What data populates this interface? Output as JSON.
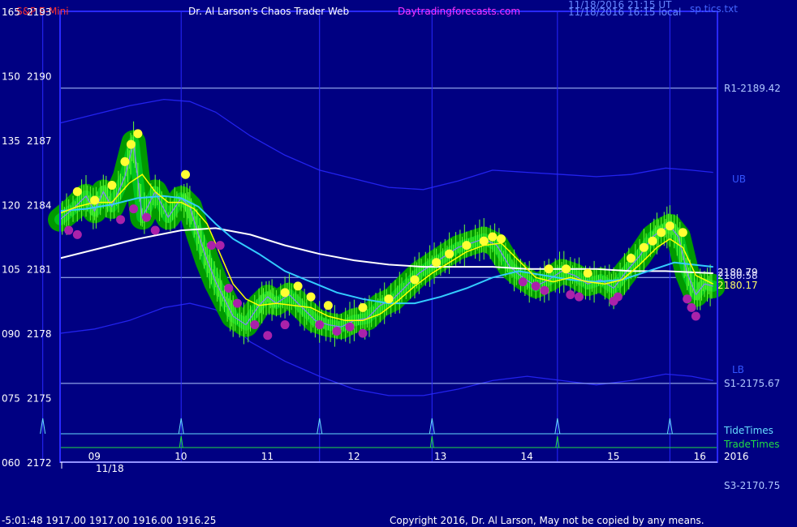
{
  "header": {
    "symbol": "S&P E-Mini",
    "site": "Dr. Al Larson's Chaos Trader Web",
    "url": "Daytradingforecasts.com",
    "stamp1": "11/18/2016 21:15 UT",
    "stamp2": "11/18/2016 16:15 local",
    "file": "sp.tics.txt"
  },
  "footer": {
    "quote": "-5:01:48  1917.00 1917.00 1916.00 1916.25",
    "copyright": "Copyright 2016, Dr. Al Larson, May not be copied by any means."
  },
  "colors": {
    "background": "#000082",
    "price_line": "#8080ff",
    "grid": "#2828ff",
    "ema_yellow": "#ffff00",
    "ema_cyan": "#33ccff",
    "ema_white": "#ffffff",
    "band": "#2222ee",
    "tide": "#66ddff",
    "trade": "#22dd44",
    "dot_yellow": "#ffff33",
    "dot_magenta": "#aa22aa",
    "halo": "#009900"
  },
  "chart_data": {
    "type": "line",
    "title": "S&P E-Mini",
    "ylim": [
      2172,
      2193
    ],
    "xlim": [
      8.6,
      16.2
    ],
    "y_ticks": [
      {
        "left": "165",
        "right": "2193",
        "y": 2193
      },
      {
        "left": "150",
        "right": "2190",
        "y": 2190
      },
      {
        "left": "135",
        "right": "2187",
        "y": 2187
      },
      {
        "left": "120",
        "right": "2184",
        "y": 2184
      },
      {
        "left": "105",
        "right": "2181",
        "y": 2181
      },
      {
        "left": "090",
        "right": "2178",
        "y": 2178
      },
      {
        "left": "075",
        "right": "2175",
        "y": 2175
      },
      {
        "left": "060",
        "right": "2172",
        "y": 2172
      }
    ],
    "x_ticks": [
      {
        "label": "09",
        "x": 9.0
      },
      {
        "label": "10",
        "x": 10.0
      },
      {
        "label": "11",
        "x": 11.0
      },
      {
        "label": "12",
        "x": 12.0
      },
      {
        "label": "13",
        "x": 13.0
      },
      {
        "label": "14",
        "x": 14.0
      },
      {
        "label": "15",
        "x": 15.0
      },
      {
        "label": "16",
        "x": 16.0
      }
    ],
    "date_label": "11/18",
    "levels": [
      {
        "label": "R1-2189.42",
        "value": 2189.42
      },
      {
        "label": "S1-2175.67",
        "value": 2175.67
      }
    ],
    "below_label": "S3-2170.75",
    "band_labels": {
      "upper": "UB",
      "lower": "LB"
    },
    "last_values": [
      "2180.79",
      "2180.58",
      "2180.17"
    ],
    "year_label": "2016",
    "vertical_times": [
      8.4,
      10.0,
      11.6,
      12.9,
      14.35,
      15.65
    ],
    "tide": {
      "label": "TideTimes",
      "times": [
        8.4,
        10.0,
        11.6,
        12.9,
        14.35,
        15.65
      ]
    },
    "trade": {
      "label": "TradeTimes",
      "times": [
        10.0,
        12.9,
        14.35
      ]
    },
    "series": [
      {
        "key": "price",
        "x": [
          8.6,
          8.75,
          8.9,
          9.0,
          9.1,
          9.2,
          9.35,
          9.45,
          9.55,
          9.7,
          9.85,
          10.0,
          10.1,
          10.2,
          10.3,
          10.4,
          10.5,
          10.6,
          10.75,
          10.9,
          11.0,
          11.1,
          11.25,
          11.4,
          11.55,
          11.7,
          11.85,
          12.0,
          12.15,
          12.3,
          12.45,
          12.6,
          12.75,
          12.9,
          13.05,
          13.2,
          13.35,
          13.5,
          13.65,
          13.8,
          13.95,
          14.1,
          14.25,
          14.4,
          14.55,
          14.7,
          14.85,
          15.0,
          15.15,
          15.3,
          15.45,
          15.55,
          15.65,
          15.75,
          15.85,
          15.95,
          16.05,
          16.15
        ],
        "y": [
          2183.3,
          2183.8,
          2184.4,
          2183.7,
          2184.6,
          2183.9,
          2185.3,
          2186.9,
          2183.4,
          2184.6,
          2183.4,
          2184.3,
          2183.9,
          2182.6,
          2181.4,
          2180.4,
          2179.6,
          2178.8,
          2178.4,
          2179.3,
          2179.7,
          2179.4,
          2179.8,
          2179.2,
          2178.6,
          2178.4,
          2178.3,
          2178.6,
          2178.7,
          2179.3,
          2179.6,
          2180.2,
          2180.8,
          2181.2,
          2181.6,
          2182.0,
          2182.2,
          2182.4,
          2182.1,
          2181.1,
          2180.6,
          2180.2,
          2180.5,
          2180.9,
          2180.7,
          2180.3,
          2180.5,
          2180.1,
          2180.9,
          2181.6,
          2182.5,
          2182.8,
          2183.0,
          2182.5,
          2180.8,
          2179.8,
          2180.3,
          2180.2
        ]
      },
      {
        "key": "ema_fast",
        "x": [
          8.6,
          8.8,
          9.0,
          9.2,
          9.4,
          9.55,
          9.7,
          9.85,
          10.0,
          10.15,
          10.3,
          10.45,
          10.6,
          10.75,
          10.9,
          11.1,
          11.3,
          11.5,
          11.7,
          11.9,
          12.1,
          12.3,
          12.5,
          12.7,
          12.9,
          13.1,
          13.3,
          13.5,
          13.7,
          13.9,
          14.1,
          14.3,
          14.5,
          14.7,
          14.9,
          15.1,
          15.3,
          15.5,
          15.65,
          15.8,
          15.95,
          16.15
        ],
        "y": [
          2183.6,
          2183.9,
          2184.1,
          2184.1,
          2185.0,
          2185.4,
          2184.6,
          2184.1,
          2184.1,
          2183.8,
          2183.1,
          2181.7,
          2180.3,
          2179.6,
          2179.3,
          2179.4,
          2179.3,
          2179.2,
          2178.8,
          2178.6,
          2178.6,
          2178.9,
          2179.5,
          2180.2,
          2180.8,
          2181.3,
          2181.8,
          2182.1,
          2182.2,
          2181.4,
          2180.6,
          2180.4,
          2180.6,
          2180.4,
          2180.3,
          2180.5,
          2181.2,
          2182.0,
          2182.4,
          2182.0,
          2180.7,
          2180.3
        ]
      },
      {
        "key": "ema_cyan",
        "x": [
          8.6,
          8.9,
          9.2,
          9.5,
          9.8,
          10.0,
          10.2,
          10.4,
          10.6,
          10.9,
          11.2,
          11.5,
          11.8,
          12.1,
          12.4,
          12.7,
          13.0,
          13.3,
          13.6,
          13.9,
          14.2,
          14.5,
          14.8,
          15.1,
          15.4,
          15.7,
          16.15
        ],
        "y": [
          2183.7,
          2183.8,
          2184.0,
          2184.3,
          2184.4,
          2184.3,
          2183.9,
          2183.1,
          2182.4,
          2181.7,
          2180.9,
          2180.4,
          2179.9,
          2179.6,
          2179.4,
          2179.4,
          2179.7,
          2180.1,
          2180.6,
          2180.9,
          2180.7,
          2180.5,
          2180.4,
          2180.5,
          2180.9,
          2181.3,
          2181.1
        ]
      },
      {
        "key": "ema_slow",
        "x": [
          8.6,
          9.0,
          9.5,
          10.0,
          10.4,
          10.8,
          11.2,
          11.6,
          12.0,
          12.4,
          12.8,
          13.2,
          13.6,
          14.0,
          14.4,
          14.8,
          15.2,
          15.6,
          16.15
        ],
        "y": [
          2181.5,
          2181.9,
          2182.4,
          2182.8,
          2182.9,
          2182.6,
          2182.1,
          2181.7,
          2181.4,
          2181.2,
          2181.1,
          2181.1,
          2181.1,
          2181.0,
          2181.0,
          2181.0,
          2180.9,
          2180.9,
          2180.8
        ]
      },
      {
        "key": "upper_band",
        "x": [
          8.6,
          9.0,
          9.4,
          9.8,
          10.1,
          10.4,
          10.8,
          11.2,
          11.6,
          12.0,
          12.4,
          12.8,
          13.2,
          13.6,
          14.0,
          14.4,
          14.8,
          15.2,
          15.6,
          15.9,
          16.15
        ],
        "y": [
          2187.8,
          2188.2,
          2188.6,
          2188.9,
          2188.8,
          2188.3,
          2187.2,
          2186.3,
          2185.6,
          2185.2,
          2184.8,
          2184.7,
          2185.1,
          2185.6,
          2185.5,
          2185.4,
          2185.3,
          2185.4,
          2185.7,
          2185.6,
          2185.5
        ]
      },
      {
        "key": "lower_band",
        "x": [
          8.6,
          9.0,
          9.4,
          9.8,
          10.1,
          10.4,
          10.8,
          11.2,
          11.6,
          12.0,
          12.4,
          12.8,
          13.2,
          13.6,
          14.0,
          14.4,
          14.8,
          15.2,
          15.6,
          15.9,
          16.15
        ],
        "y": [
          2178.0,
          2178.2,
          2178.6,
          2179.2,
          2179.4,
          2179.1,
          2177.6,
          2176.7,
          2176.0,
          2175.4,
          2175.1,
          2175.1,
          2175.4,
          2175.8,
          2176.0,
          2175.8,
          2175.6,
          2175.8,
          2176.1,
          2176.0,
          2175.8
        ]
      }
    ],
    "markers": {
      "yellow": {
        "x": [
          8.8,
          9.0,
          9.2,
          9.35,
          9.42,
          9.5,
          10.05,
          11.2,
          11.35,
          11.5,
          11.7,
          12.1,
          12.4,
          12.7,
          12.95,
          13.1,
          13.3,
          13.5,
          13.6,
          13.7,
          14.25,
          14.45,
          14.7,
          15.2,
          15.35,
          15.45,
          15.55,
          15.65,
          15.8
        ],
        "y": [
          2184.6,
          2184.2,
          2184.9,
          2186.0,
          2186.8,
          2187.3,
          2185.4,
          2179.9,
          2180.2,
          2179.7,
          2179.3,
          2179.2,
          2179.6,
          2180.5,
          2181.3,
          2181.7,
          2182.1,
          2182.3,
          2182.5,
          2182.4,
          2181.0,
          2181.0,
          2180.8,
          2181.5,
          2182.0,
          2182.3,
          2182.7,
          2183.0,
          2182.7
        ]
      },
      "magenta": {
        "x": [
          8.7,
          8.8,
          9.3,
          9.45,
          9.6,
          9.7,
          10.35,
          10.45,
          10.55,
          10.65,
          10.85,
          11.0,
          11.2,
          11.6,
          11.8,
          11.95,
          12.1,
          13.95,
          14.1,
          14.2,
          14.5,
          14.6,
          15.0,
          15.05,
          15.85,
          15.9,
          15.95
        ],
        "y": [
          2182.8,
          2182.6,
          2183.3,
          2183.8,
          2183.4,
          2182.8,
          2182.1,
          2182.1,
          2180.1,
          2179.4,
          2178.4,
          2177.9,
          2178.4,
          2178.4,
          2178.1,
          2178.3,
          2178.0,
          2180.4,
          2180.2,
          2180.0,
          2179.8,
          2179.7,
          2179.5,
          2179.7,
          2179.6,
          2179.2,
          2178.8
        ]
      }
    }
  }
}
